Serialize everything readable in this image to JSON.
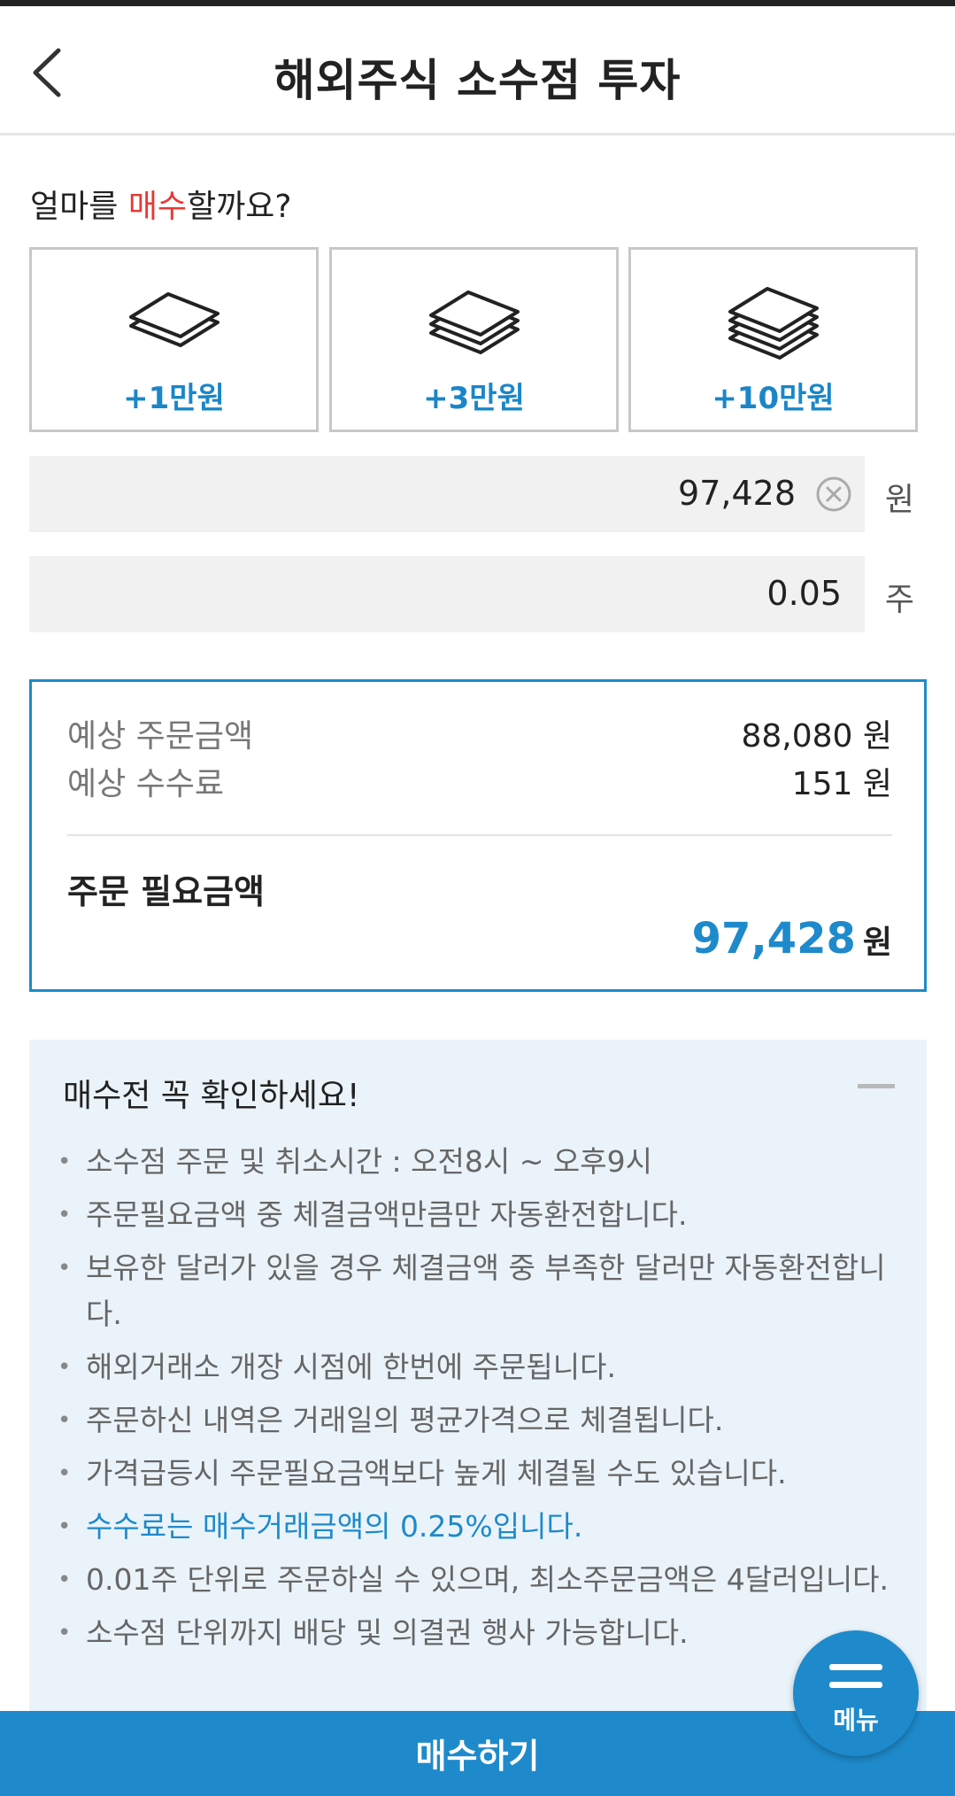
{
  "header": {
    "title": "해외주식 소수점 투자"
  },
  "question": {
    "prefix": "얼마를 ",
    "highlight": "매수",
    "suffix": "할까요?"
  },
  "amount_buttons": [
    {
      "label": "+1만원",
      "icon": "bill-stack-2-icon"
    },
    {
      "label": "+3만원",
      "icon": "bill-stack-3-icon"
    },
    {
      "label": "+10만원",
      "icon": "bill-stack-4-icon"
    }
  ],
  "amount_field": {
    "value": "97,428",
    "unit": "원"
  },
  "shares_field": {
    "value": "0.05",
    "unit": "주"
  },
  "summary": {
    "expected_order_label": "예상 주문금액",
    "expected_order_value": "88,080 원",
    "expected_fee_label": "예상 수수료",
    "expected_fee_value": "151 원",
    "required_label": "주문 필요금액",
    "required_value": "97,428",
    "required_unit": "원"
  },
  "notice": {
    "title": "매수전 꼭 확인하세요!",
    "items": [
      "소수점 주문 및 취소시간 : 오전8시 ~ 오후9시",
      "주문필요금액 중 체결금액만큼만 자동환전합니다.",
      "보유한 달러가 있을 경우 체결금액 중 부족한 달러만 자동환전합니다.",
      "해외거래소 개장 시점에 한번에 주문됩니다.",
      "주문하신 내역은 거래일의 평균가격으로 체결됩니다.",
      "가격급등시 주문필요금액보다 높게 체결될 수도 있습니다.",
      "수수료는 매수거래금액의 0.25%입니다.",
      "0.01주 단위로 주문하실 수 있으며, 최소주문금액은 4달러입니다.",
      "소수점 단위까지 배당 및 의결권 행사 가능합니다."
    ]
  },
  "buy_button": {
    "label": "매수하기"
  },
  "menu_fab": {
    "label": "메뉴"
  },
  "colors": {
    "accent": "#1e8acb",
    "highlight": "#e53935"
  }
}
